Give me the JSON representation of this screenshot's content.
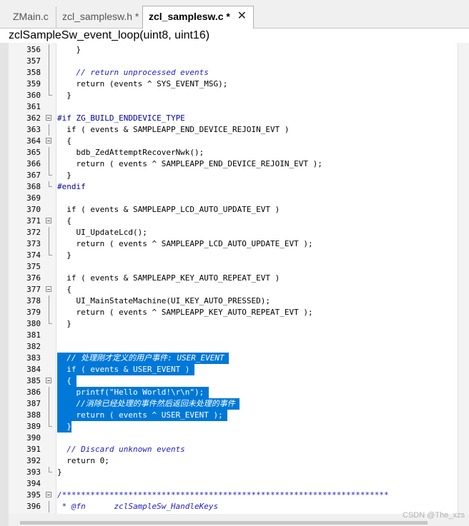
{
  "tabs": [
    {
      "label": "ZMain.c"
    },
    {
      "label": "zcl_samplesw.h *"
    },
    {
      "label": "zcl_samplesw.c *",
      "close": "✕"
    }
  ],
  "function_bar": "zclSampleSw_event_loop(uint8, uint16)",
  "watermark": "CSDN @The_xzs",
  "colors": {
    "selection": "#0078d7",
    "comment": "#2020c0",
    "preprocessor": "#0000a0"
  },
  "lines": [
    {
      "n": "356",
      "text": "    }",
      "fold": "v"
    },
    {
      "n": "357",
      "text": "",
      "fold": "v"
    },
    {
      "n": "358",
      "text": "    // return unprocessed events",
      "fold": "v",
      "style": "cm"
    },
    {
      "n": "359",
      "text": "    return (events ^ SYS_EVENT_MSG);",
      "fold": "v"
    },
    {
      "n": "360",
      "text": "  }",
      "fold": "end"
    },
    {
      "n": "361",
      "text": "",
      "fold": "none"
    },
    {
      "n": "362",
      "text": "#if ZG_BUILD_ENDDEVICE_TYPE",
      "fold": "box"
    },
    {
      "n": "363",
      "text": "  if ( events & SAMPLEAPP_END_DEVICE_REJOIN_EVT )",
      "fold": "v"
    },
    {
      "n": "364",
      "text": "  {",
      "fold": "box"
    },
    {
      "n": "365",
      "text": "    bdb_ZedAttemptRecoverNwk();",
      "fold": "v"
    },
    {
      "n": "366",
      "text": "    return ( events ^ SAMPLEAPP_END_DEVICE_REJOIN_EVT );",
      "fold": "v"
    },
    {
      "n": "367",
      "text": "  }",
      "fold": "end"
    },
    {
      "n": "368",
      "text": "#endif",
      "fold": "end"
    },
    {
      "n": "369",
      "text": "",
      "fold": "none"
    },
    {
      "n": "370",
      "text": "  if ( events & SAMPLEAPP_LCD_AUTO_UPDATE_EVT )",
      "fold": "none"
    },
    {
      "n": "371",
      "text": "  {",
      "fold": "box"
    },
    {
      "n": "372",
      "text": "    UI_UpdateLcd();",
      "fold": "v"
    },
    {
      "n": "373",
      "text": "    return ( events ^ SAMPLEAPP_LCD_AUTO_UPDATE_EVT );",
      "fold": "v"
    },
    {
      "n": "374",
      "text": "  }",
      "fold": "end"
    },
    {
      "n": "375",
      "text": "",
      "fold": "none"
    },
    {
      "n": "376",
      "text": "  if ( events & SAMPLEAPP_KEY_AUTO_REPEAT_EVT )",
      "fold": "none"
    },
    {
      "n": "377",
      "text": "  {",
      "fold": "box"
    },
    {
      "n": "378",
      "text": "    UI_MainStateMachine(UI_KEY_AUTO_PRESSED);",
      "fold": "v"
    },
    {
      "n": "379",
      "text": "    return ( events ^ SAMPLEAPP_KEY_AUTO_REPEAT_EVT );",
      "fold": "v"
    },
    {
      "n": "380",
      "text": "  }",
      "fold": "end"
    },
    {
      "n": "381",
      "text": "",
      "fold": "none"
    },
    {
      "n": "382",
      "text": "",
      "fold": "none"
    },
    {
      "n": "383",
      "text": "  // 处理刚才定义的用户事件: USER_EVENT ",
      "fold": "none",
      "sel": true
    },
    {
      "n": "384",
      "text": "  if ( events & USER_EVENT ) ",
      "fold": "none",
      "sel": true
    },
    {
      "n": "385",
      "text": "  { ",
      "fold": "box",
      "sel": true
    },
    {
      "n": "386",
      "text": "    printf(\"Hello World!\\r\\n\"); ",
      "fold": "v",
      "sel": true
    },
    {
      "n": "387",
      "text": "    //消除已经处理的事件然后返回未处理的事件 ",
      "fold": "v",
      "sel": true
    },
    {
      "n": "388",
      "text": "    return ( events ^ USER_EVENT ); ",
      "fold": "v",
      "sel": true
    },
    {
      "n": "389",
      "text": "  }",
      "fold": "end",
      "sel": true
    },
    {
      "n": "390",
      "text": "",
      "fold": "none"
    },
    {
      "n": "391",
      "text": "  // Discard unknown events",
      "fold": "none",
      "style": "cm"
    },
    {
      "n": "392",
      "text": "  return 0;",
      "fold": "none"
    },
    {
      "n": "393",
      "text": "}",
      "fold": "end"
    },
    {
      "n": "394",
      "text": "",
      "fold": "none"
    },
    {
      "n": "395",
      "text": "/*********************************************************************",
      "fold": "box",
      "style": "cm"
    },
    {
      "n": "396",
      "text": " * @fn      zclSampleSw_HandleKeys",
      "fold": "v",
      "style": "cm"
    }
  ]
}
